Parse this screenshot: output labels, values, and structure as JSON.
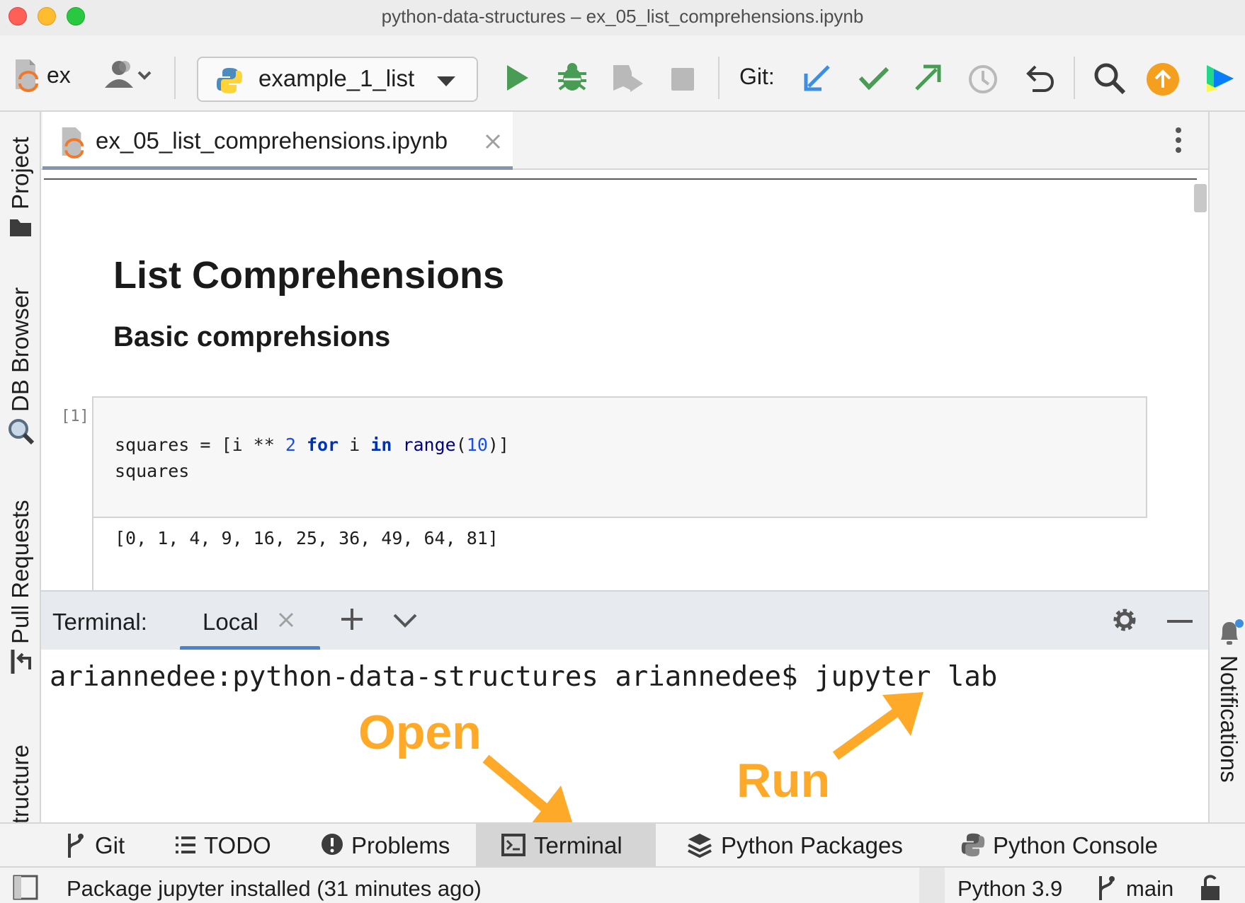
{
  "window": {
    "title": "python-data-structures – ex_05_list_comprehensions.ipynb"
  },
  "toolbar": {
    "project_label": "ex",
    "run_config": "example_1_list",
    "git_label": "Git:"
  },
  "left_strip": {
    "items": [
      "Project",
      "DB Browser",
      "Pull Requests",
      "Structure"
    ]
  },
  "right_strip": {
    "notifications": "Notifications"
  },
  "editor": {
    "tab_label": "ex_05_list_comprehensions.ipynb"
  },
  "notebook": {
    "heading1": "List Comprehensions",
    "heading2": "Basic comprehsions",
    "cell_number": "[1]",
    "output": "[0, 1, 4, 9, 16, 25, 36, 49, 64, 81]"
  },
  "terminal": {
    "title": "Terminal:",
    "tab_label": "Local",
    "command_line": "ariannedee:python-data-structures ariannedee$ jupyter lab"
  },
  "annotations": {
    "open": "Open",
    "run": "Run",
    "color": "#ffa928"
  },
  "bottom_tools": {
    "git": "Git",
    "todo": "TODO",
    "problems": "Problems",
    "terminal": "Terminal",
    "python_packages": "Python Packages",
    "python_console": "Python Console"
  },
  "status": {
    "message": "Package jupyter installed (31 minutes ago)",
    "interpreter": "Python 3.9",
    "branch": "main"
  },
  "colors": {
    "run_green": "#499c54",
    "git_blue": "#3d8ee0",
    "update_orange": "#f59f1f",
    "keyword_blue": "#0033b3"
  }
}
